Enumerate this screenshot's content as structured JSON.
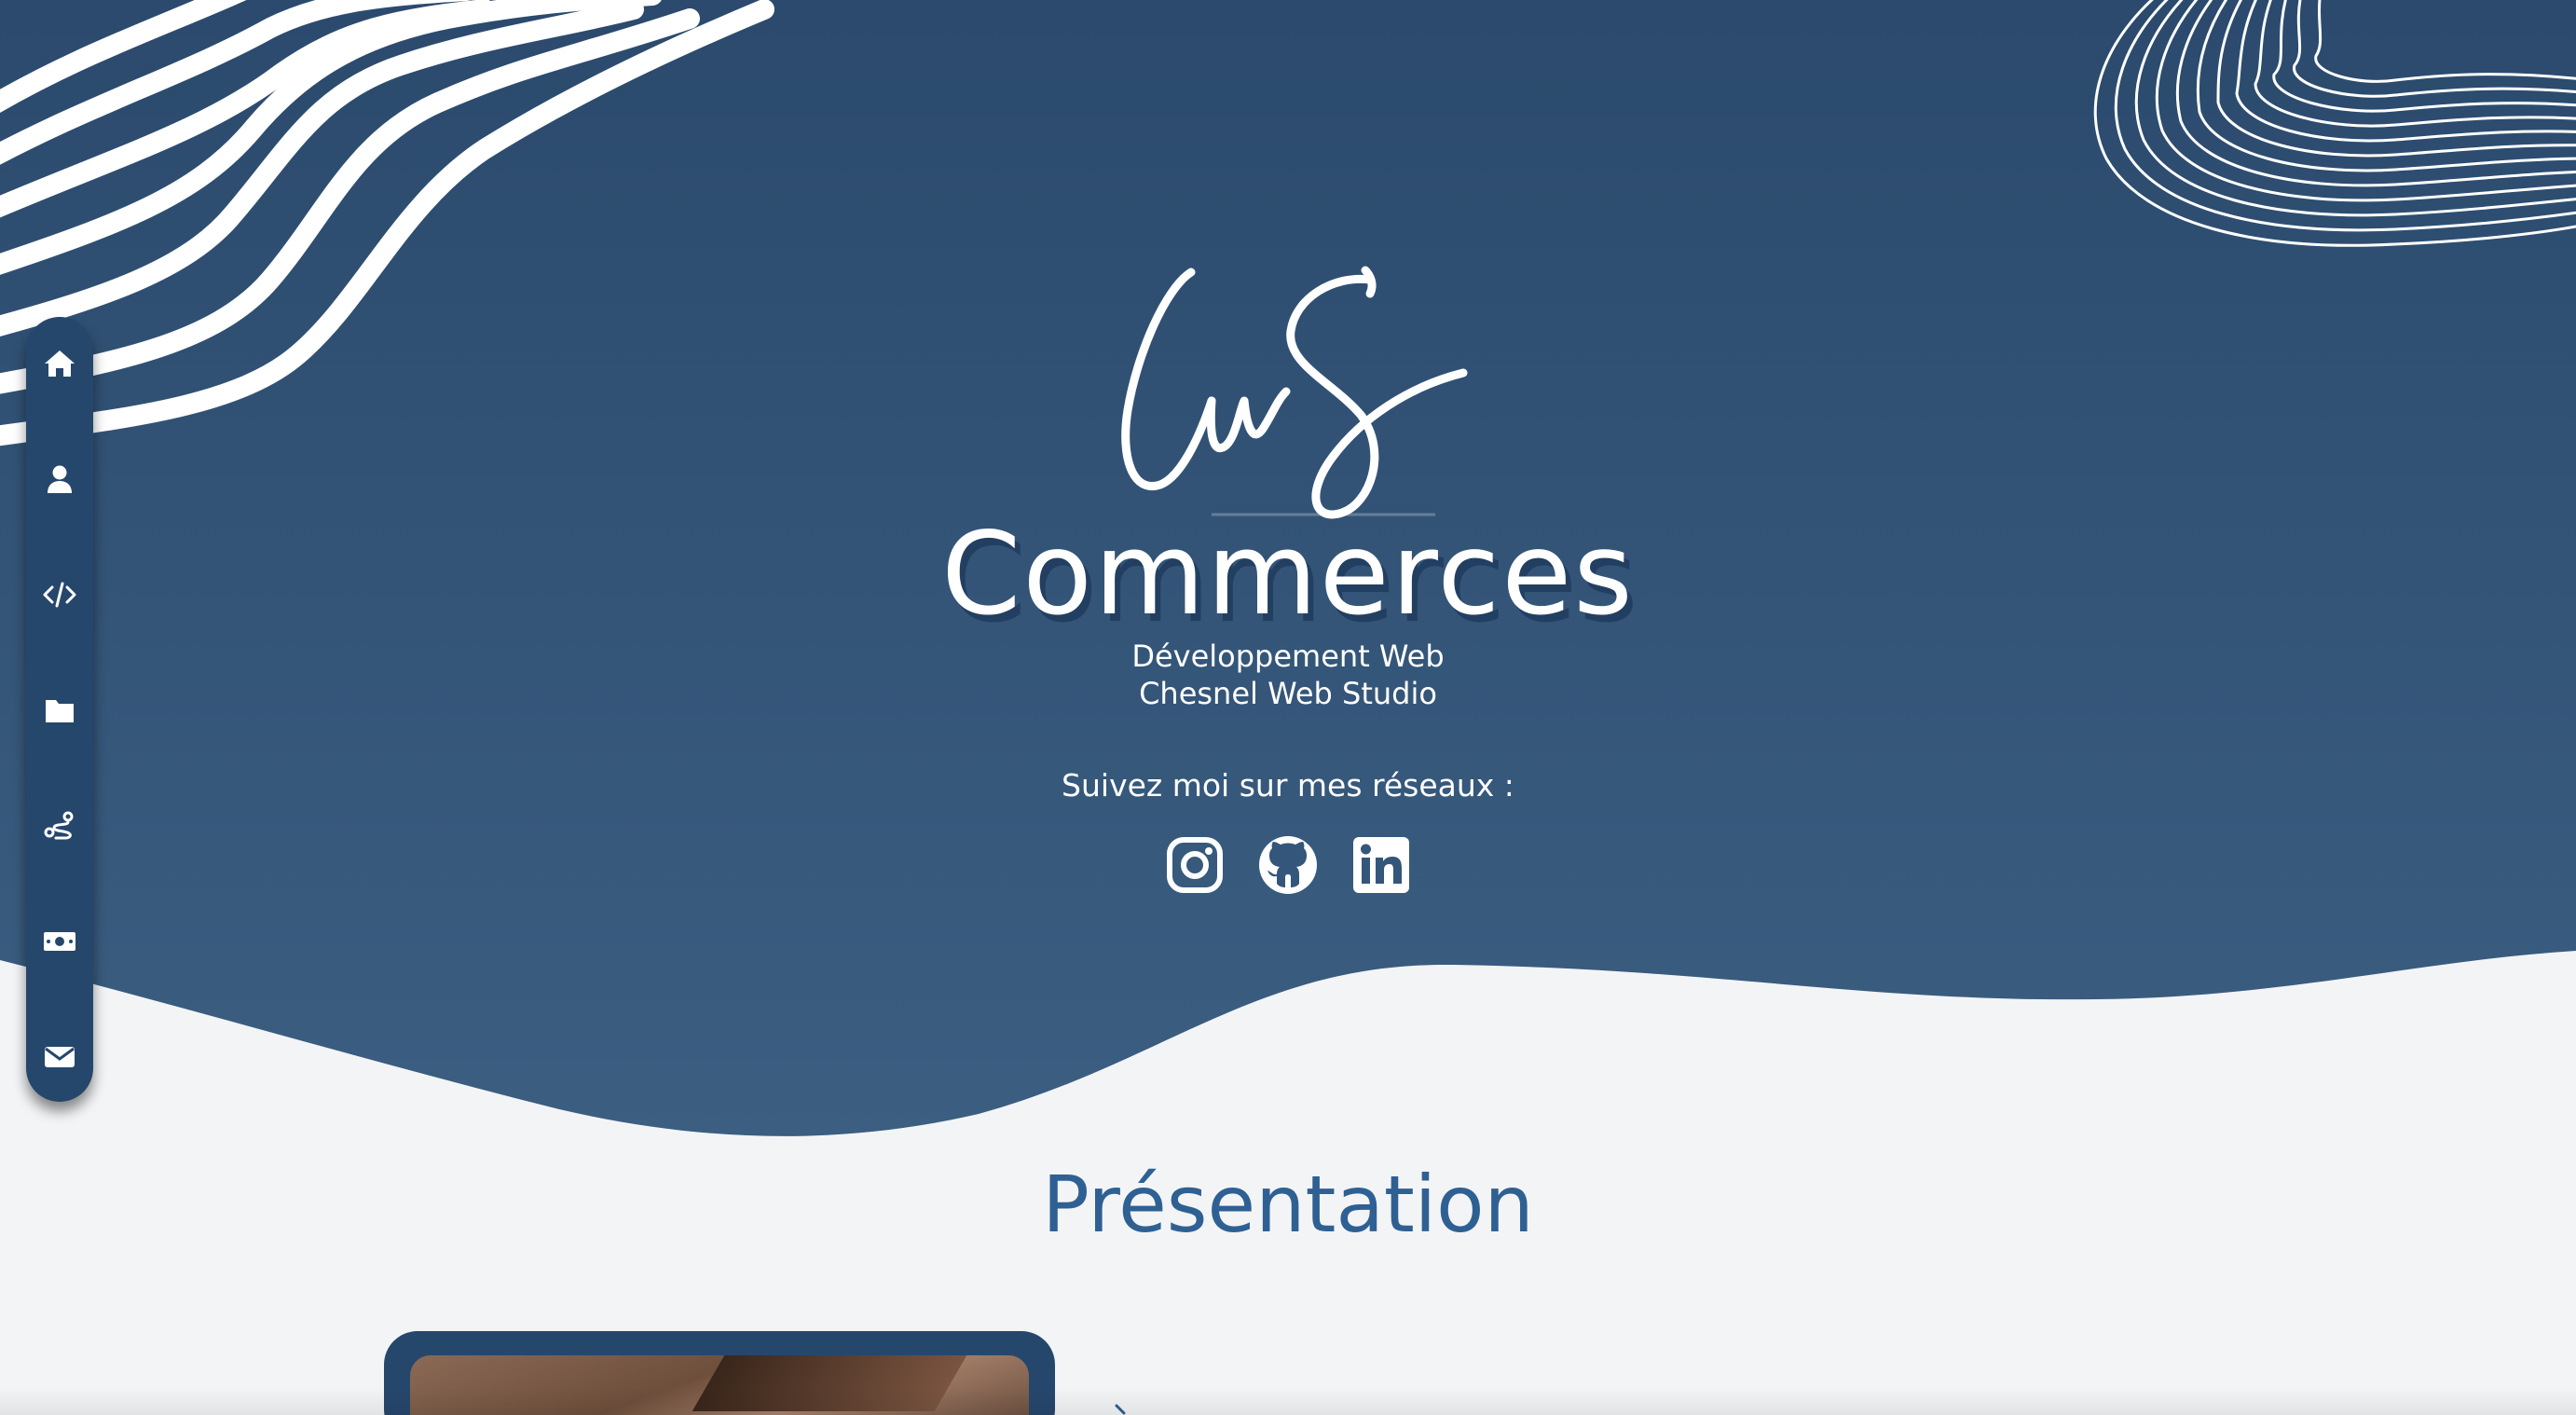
{
  "colors": {
    "hero_top": "#2b4a6e",
    "hero_bottom": "#3a5d80",
    "sidebar": "#26476c",
    "page_bg": "#f3f4f6",
    "title_blue": "#2f6093",
    "text": "#ffffff"
  },
  "hero": {
    "logo_icon": "cws-signature-logo",
    "brand": "Commerces",
    "subtitle_line1": "Développement Web",
    "subtitle_line2": "Chesnel Web Studio",
    "follow_text": "Suivez moi sur mes réseaux :",
    "socials": [
      {
        "name": "instagram",
        "icon": "instagram-icon"
      },
      {
        "name": "github",
        "icon": "github-icon"
      },
      {
        "name": "linkedin",
        "icon": "linkedin-icon"
      }
    ]
  },
  "sidebar": {
    "items": [
      {
        "id": "home",
        "icon": "home-icon"
      },
      {
        "id": "about",
        "icon": "user-icon"
      },
      {
        "id": "skills",
        "icon": "code-icon"
      },
      {
        "id": "projects",
        "icon": "folder-icon"
      },
      {
        "id": "route",
        "icon": "route-icon"
      },
      {
        "id": "pricing",
        "icon": "money-icon"
      },
      {
        "id": "contact",
        "icon": "envelope-icon"
      }
    ]
  },
  "presentation": {
    "title": "Présentation"
  }
}
